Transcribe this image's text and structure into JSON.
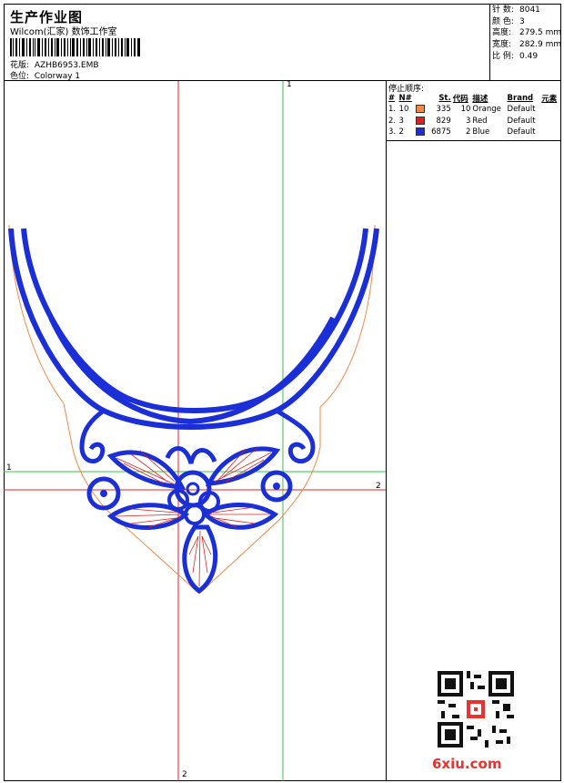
{
  "header": {
    "title": "生产作业图",
    "studio": "Wilcom(汇家) 数饰工作室",
    "design_label": "花版:",
    "design_file": "AZHB6953.EMB",
    "colorway_label": "色位:",
    "colorway": "Colorway 1"
  },
  "stats": [
    {
      "label": "针 数:",
      "value": "8041"
    },
    {
      "label": "颜 色:",
      "value": "3"
    },
    {
      "label": "高度:",
      "value": "279.5 mm"
    },
    {
      "label": "宽度:",
      "value": "282.9 mm"
    },
    {
      "label": "比 例:",
      "value": "0.49"
    }
  ],
  "stop_sequence": {
    "title": "停止顺序:",
    "headers": [
      "#",
      "N#",
      "St.",
      "代码",
      "描述",
      "Brand",
      "元素"
    ],
    "rows": [
      {
        "num": "1.",
        "n": "10",
        "color": "#f2894a",
        "st": "335",
        "code": "10",
        "desc": "Orange",
        "brand": "Default",
        "elem": ""
      },
      {
        "num": "2.",
        "n": "3",
        "color": "#e02020",
        "st": "829",
        "code": "3",
        "desc": "Red",
        "brand": "Default",
        "elem": ""
      },
      {
        "num": "3.",
        "n": "2",
        "color": "#1a2fd8",
        "st": "6875",
        "code": "2",
        "desc": "Blue",
        "brand": "Default",
        "elem": ""
      }
    ]
  },
  "canvas": {
    "axis_labels": {
      "green_vertical": "1",
      "green_horizontal": "1",
      "red_horizontal": "2",
      "red_vertical": "2"
    }
  },
  "watermark": {
    "brand": "6xiu.com"
  },
  "colors": {
    "orange": "#f2894a",
    "red": "#e02020",
    "blue": "#1a2fd8",
    "green": "#2ecc40"
  }
}
